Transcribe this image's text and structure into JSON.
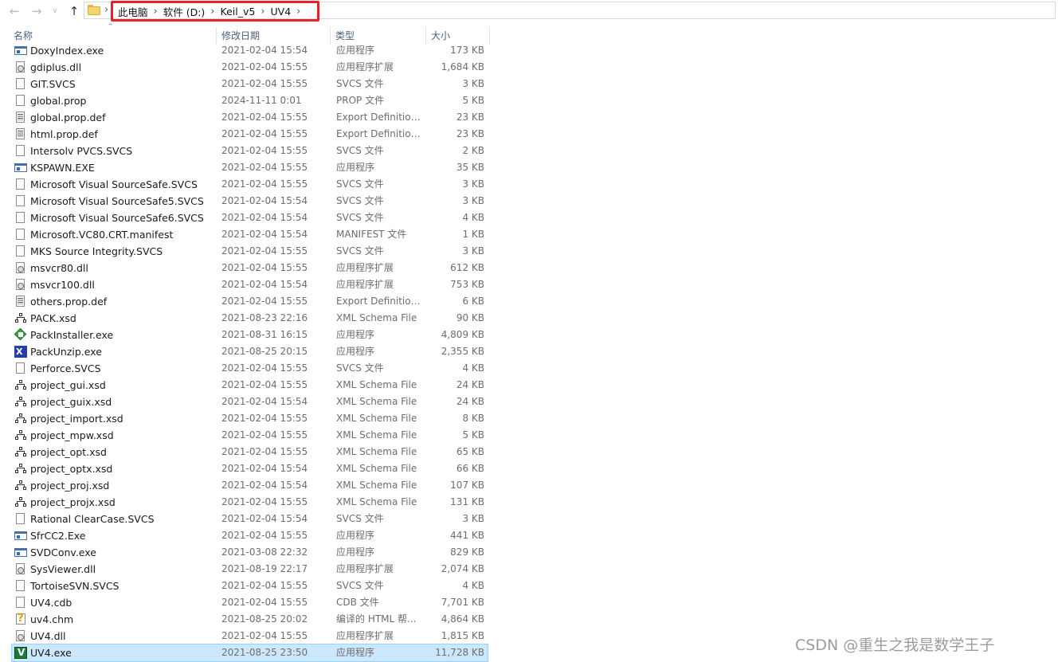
{
  "nav": {
    "back_icon": "arrow-left-icon",
    "forward_icon": "arrow-right-icon",
    "recent_icon": "chevron-down-icon",
    "up_icon": "arrow-up-icon"
  },
  "address": {
    "crumbs": [
      "此电脑",
      "软件 (D:)",
      "Keil_v5",
      "UV4"
    ],
    "highlight_color": "#e8202a"
  },
  "columns": {
    "name": "名称",
    "date": "修改日期",
    "type": "类型",
    "size": "大小"
  },
  "files": [
    {
      "name": "DoxyIndex.exe",
      "date": "2021-02-04 15:54",
      "type": "应用程序",
      "size": "173 KB",
      "icon": "exe"
    },
    {
      "name": "gdiplus.dll",
      "date": "2021-02-04 15:55",
      "type": "应用程序扩展",
      "size": "1,684 KB",
      "icon": "dll"
    },
    {
      "name": "GIT.SVCS",
      "date": "2021-02-04 15:55",
      "type": "SVCS 文件",
      "size": "3 KB",
      "icon": "blank"
    },
    {
      "name": "global.prop",
      "date": "2024-11-11 0:01",
      "type": "PROP 文件",
      "size": "5 KB",
      "icon": "blank"
    },
    {
      "name": "global.prop.def",
      "date": "2021-02-04 15:55",
      "type": "Export Definition...",
      "size": "23 KB",
      "icon": "text"
    },
    {
      "name": "html.prop.def",
      "date": "2021-02-04 15:55",
      "type": "Export Definition...",
      "size": "23 KB",
      "icon": "text"
    },
    {
      "name": "Intersolv PVCS.SVCS",
      "date": "2021-02-04 15:55",
      "type": "SVCS 文件",
      "size": "2 KB",
      "icon": "blank"
    },
    {
      "name": "KSPAWN.EXE",
      "date": "2021-02-04 15:55",
      "type": "应用程序",
      "size": "35 KB",
      "icon": "exe"
    },
    {
      "name": "Microsoft Visual SourceSafe.SVCS",
      "date": "2021-02-04 15:55",
      "type": "SVCS 文件",
      "size": "3 KB",
      "icon": "blank"
    },
    {
      "name": "Microsoft Visual SourceSafe5.SVCS",
      "date": "2021-02-04 15:54",
      "type": "SVCS 文件",
      "size": "3 KB",
      "icon": "blank"
    },
    {
      "name": "Microsoft Visual SourceSafe6.SVCS",
      "date": "2021-02-04 15:54",
      "type": "SVCS 文件",
      "size": "4 KB",
      "icon": "blank"
    },
    {
      "name": "Microsoft.VC80.CRT.manifest",
      "date": "2021-02-04 15:54",
      "type": "MANIFEST 文件",
      "size": "1 KB",
      "icon": "blank"
    },
    {
      "name": "MKS Source Integrity.SVCS",
      "date": "2021-02-04 15:55",
      "type": "SVCS 文件",
      "size": "3 KB",
      "icon": "blank"
    },
    {
      "name": "msvcr80.dll",
      "date": "2021-02-04 15:55",
      "type": "应用程序扩展",
      "size": "612 KB",
      "icon": "dll"
    },
    {
      "name": "msvcr100.dll",
      "date": "2021-02-04 15:54",
      "type": "应用程序扩展",
      "size": "753 KB",
      "icon": "dll"
    },
    {
      "name": "others.prop.def",
      "date": "2021-02-04 15:55",
      "type": "Export Definition...",
      "size": "6 KB",
      "icon": "text"
    },
    {
      "name": "PACK.xsd",
      "date": "2021-08-23 22:16",
      "type": "XML Schema File",
      "size": "90 KB",
      "icon": "xsd"
    },
    {
      "name": "PackInstaller.exe",
      "date": "2021-08-31 16:15",
      "type": "应用程序",
      "size": "4,809 KB",
      "icon": "pack"
    },
    {
      "name": "PackUnzip.exe",
      "date": "2021-08-25 20:15",
      "type": "应用程序",
      "size": "2,355 KB",
      "icon": "unzip"
    },
    {
      "name": "Perforce.SVCS",
      "date": "2021-02-04 15:55",
      "type": "SVCS 文件",
      "size": "4 KB",
      "icon": "blank"
    },
    {
      "name": "project_gui.xsd",
      "date": "2021-02-04 15:55",
      "type": "XML Schema File",
      "size": "24 KB",
      "icon": "xsd"
    },
    {
      "name": "project_guix.xsd",
      "date": "2021-02-04 15:54",
      "type": "XML Schema File",
      "size": "24 KB",
      "icon": "xsd"
    },
    {
      "name": "project_import.xsd",
      "date": "2021-02-04 15:55",
      "type": "XML Schema File",
      "size": "8 KB",
      "icon": "xsd"
    },
    {
      "name": "project_mpw.xsd",
      "date": "2021-02-04 15:55",
      "type": "XML Schema File",
      "size": "5 KB",
      "icon": "xsd"
    },
    {
      "name": "project_opt.xsd",
      "date": "2021-02-04 15:55",
      "type": "XML Schema File",
      "size": "65 KB",
      "icon": "xsd"
    },
    {
      "name": "project_optx.xsd",
      "date": "2021-02-04 15:54",
      "type": "XML Schema File",
      "size": "66 KB",
      "icon": "xsd"
    },
    {
      "name": "project_proj.xsd",
      "date": "2021-02-04 15:54",
      "type": "XML Schema File",
      "size": "107 KB",
      "icon": "xsd"
    },
    {
      "name": "project_projx.xsd",
      "date": "2021-02-04 15:55",
      "type": "XML Schema File",
      "size": "131 KB",
      "icon": "xsd"
    },
    {
      "name": "Rational ClearCase.SVCS",
      "date": "2021-02-04 15:54",
      "type": "SVCS 文件",
      "size": "3 KB",
      "icon": "blank"
    },
    {
      "name": "SfrCC2.Exe",
      "date": "2021-02-04 15:55",
      "type": "应用程序",
      "size": "441 KB",
      "icon": "exe"
    },
    {
      "name": "SVDConv.exe",
      "date": "2021-03-08 22:32",
      "type": "应用程序",
      "size": "829 KB",
      "icon": "exe"
    },
    {
      "name": "SysViewer.dll",
      "date": "2021-08-19 22:17",
      "type": "应用程序扩展",
      "size": "2,074 KB",
      "icon": "dll"
    },
    {
      "name": "TortoiseSVN.SVCS",
      "date": "2021-02-04 15:55",
      "type": "SVCS 文件",
      "size": "4 KB",
      "icon": "blank"
    },
    {
      "name": "UV4.cdb",
      "date": "2021-02-04 15:55",
      "type": "CDB 文件",
      "size": "7,701 KB",
      "icon": "blank"
    },
    {
      "name": "uv4.chm",
      "date": "2021-08-25 20:02",
      "type": "编译的 HTML 帮...",
      "size": "4,864 KB",
      "icon": "chm"
    },
    {
      "name": "UV4.dll",
      "date": "2021-02-04 15:55",
      "type": "应用程序扩展",
      "size": "1,815 KB",
      "icon": "dll"
    },
    {
      "name": "UV4.exe",
      "date": "2021-08-25 23:50",
      "type": "应用程序",
      "size": "11,728 KB",
      "icon": "uv",
      "selected": true
    }
  ],
  "watermark": "CSDN @重生之我是数学王子"
}
